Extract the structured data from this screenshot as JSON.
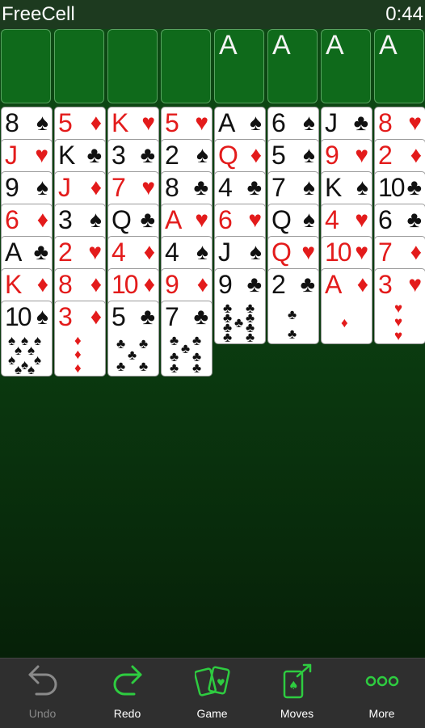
{
  "title_bar": {
    "title": "FreeCell",
    "timer": "0:44"
  },
  "free_cells": [
    {
      "label": ""
    },
    {
      "label": ""
    },
    {
      "label": ""
    },
    {
      "label": ""
    }
  ],
  "foundations": [
    {
      "label": "A"
    },
    {
      "label": "A"
    },
    {
      "label": "A"
    },
    {
      "label": "A"
    }
  ],
  "columns": [
    [
      {
        "rank": "8",
        "suit": "♠",
        "color": "black"
      },
      {
        "rank": "J",
        "suit": "♥",
        "color": "red"
      },
      {
        "rank": "9",
        "suit": "♠",
        "color": "black"
      },
      {
        "rank": "6",
        "suit": "♦",
        "color": "red"
      },
      {
        "rank": "A",
        "suit": "♣",
        "color": "black"
      },
      {
        "rank": "K",
        "suit": "♦",
        "color": "red"
      },
      {
        "rank": "10",
        "suit": "♠",
        "color": "black"
      }
    ],
    [
      {
        "rank": "5",
        "suit": "♦",
        "color": "red"
      },
      {
        "rank": "K",
        "suit": "♣",
        "color": "black"
      },
      {
        "rank": "J",
        "suit": "♦",
        "color": "red"
      },
      {
        "rank": "3",
        "suit": "♠",
        "color": "black"
      },
      {
        "rank": "2",
        "suit": "♥",
        "color": "red"
      },
      {
        "rank": "8",
        "suit": "♦",
        "color": "red"
      },
      {
        "rank": "3",
        "suit": "♦",
        "color": "red"
      }
    ],
    [
      {
        "rank": "K",
        "suit": "♥",
        "color": "red"
      },
      {
        "rank": "3",
        "suit": "♣",
        "color": "black"
      },
      {
        "rank": "7",
        "suit": "♥",
        "color": "red"
      },
      {
        "rank": "Q",
        "suit": "♣",
        "color": "black"
      },
      {
        "rank": "4",
        "suit": "♦",
        "color": "red"
      },
      {
        "rank": "10",
        "suit": "♦",
        "color": "red"
      },
      {
        "rank": "5",
        "suit": "♣",
        "color": "black"
      }
    ],
    [
      {
        "rank": "5",
        "suit": "♥",
        "color": "red"
      },
      {
        "rank": "2",
        "suit": "♠",
        "color": "black"
      },
      {
        "rank": "8",
        "suit": "♣",
        "color": "black"
      },
      {
        "rank": "A",
        "suit": "♥",
        "color": "red"
      },
      {
        "rank": "4",
        "suit": "♠",
        "color": "black"
      },
      {
        "rank": "9",
        "suit": "♦",
        "color": "red"
      },
      {
        "rank": "7",
        "suit": "♣",
        "color": "black"
      }
    ],
    [
      {
        "rank": "A",
        "suit": "♠",
        "color": "black"
      },
      {
        "rank": "Q",
        "suit": "♦",
        "color": "red"
      },
      {
        "rank": "4",
        "suit": "♣",
        "color": "black"
      },
      {
        "rank": "6",
        "suit": "♥",
        "color": "red"
      },
      {
        "rank": "J",
        "suit": "♠",
        "color": "black"
      },
      {
        "rank": "9",
        "suit": "♣",
        "color": "black"
      }
    ],
    [
      {
        "rank": "6",
        "suit": "♠",
        "color": "black"
      },
      {
        "rank": "5",
        "suit": "♠",
        "color": "black"
      },
      {
        "rank": "7",
        "suit": "♠",
        "color": "black"
      },
      {
        "rank": "Q",
        "suit": "♠",
        "color": "black"
      },
      {
        "rank": "Q",
        "suit": "♥",
        "color": "red"
      },
      {
        "rank": "2",
        "suit": "♣",
        "color": "black"
      }
    ],
    [
      {
        "rank": "J",
        "suit": "♣",
        "color": "black"
      },
      {
        "rank": "9",
        "suit": "♥",
        "color": "red"
      },
      {
        "rank": "K",
        "suit": "♠",
        "color": "black"
      },
      {
        "rank": "4",
        "suit": "♥",
        "color": "red"
      },
      {
        "rank": "10",
        "suit": "♥",
        "color": "red"
      },
      {
        "rank": "A",
        "suit": "♦",
        "color": "red"
      }
    ],
    [
      {
        "rank": "8",
        "suit": "♥",
        "color": "red"
      },
      {
        "rank": "2",
        "suit": "♦",
        "color": "red"
      },
      {
        "rank": "10",
        "suit": "♣",
        "color": "black"
      },
      {
        "rank": "6",
        "suit": "♣",
        "color": "black"
      },
      {
        "rank": "7",
        "suit": "♦",
        "color": "red"
      },
      {
        "rank": "3",
        "suit": "♥",
        "color": "red"
      }
    ]
  ],
  "toolbar": {
    "undo": {
      "label": "Undo",
      "icon": "undo-arrow-icon",
      "enabled": false
    },
    "redo": {
      "label": "Redo",
      "icon": "redo-arrow-icon",
      "enabled": true
    },
    "game": {
      "label": "Game",
      "icon": "cards-icon",
      "enabled": true
    },
    "moves": {
      "label": "Moves",
      "icon": "card-move-icon",
      "enabled": true
    },
    "more": {
      "label": "More",
      "icon": "three-dots-icon",
      "enabled": true
    }
  },
  "colors": {
    "felt": "#0d4a14",
    "slot_green": "#0f6a1b",
    "toolbar_bg": "#2f2f2f",
    "accent_green": "#2ecc40",
    "red_suit": "#e31b1b",
    "black_suit": "#111111"
  }
}
